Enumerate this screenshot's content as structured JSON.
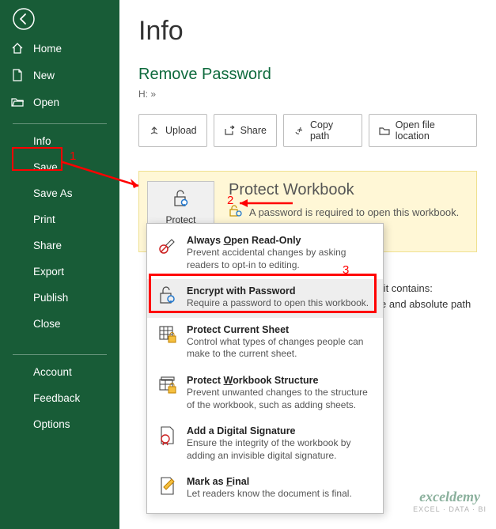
{
  "page": {
    "title": "Info",
    "doc_name": "Remove Password",
    "doc_path": "H: »"
  },
  "sidebar": {
    "home": "Home",
    "new": "New",
    "open": "Open",
    "info": "Info",
    "save": "Save",
    "save_as": "Save As",
    "print": "Print",
    "share": "Share",
    "export": "Export",
    "publish": "Publish",
    "close": "Close",
    "account": "Account",
    "feedback": "Feedback",
    "options": "Options"
  },
  "buttons": {
    "upload": "Upload",
    "share": "Share",
    "copy_path": "Copy path",
    "open_loc": "Open file location"
  },
  "protect": {
    "btn_label": "Protect Workbook",
    "dropdown_indicator": "⌄",
    "heading": "Protect Workbook",
    "msg": "A password is required to open this workbook."
  },
  "behind": {
    "l1": "hat it contains:",
    "l2": "ame and absolute path"
  },
  "dd": {
    "readonly_t": "Always Open Read-Only",
    "readonly_d": "Prevent accidental changes by asking readers to opt-in to editing.",
    "encrypt_t": "Encrypt with Password",
    "encrypt_d": "Require a password to open this workbook.",
    "sheet_t": "Protect Current Sheet",
    "sheet_d": "Control what types of changes people can make to the current sheet.",
    "struct_t": "Protect Workbook Structure",
    "struct_d": "Prevent unwanted changes to the structure of the workbook, such as adding sheets.",
    "sig_t": "Add a Digital Signature",
    "sig_d": "Ensure the integrity of the workbook by adding an invisible digital signature.",
    "final_t": "Mark as Final",
    "final_d": "Let readers know the document is final."
  },
  "ann": {
    "n1": "1",
    "n2": "2",
    "n3": "3"
  },
  "watermark": {
    "brand": "exceldemy",
    "tag": "EXCEL · DATA · BI"
  }
}
